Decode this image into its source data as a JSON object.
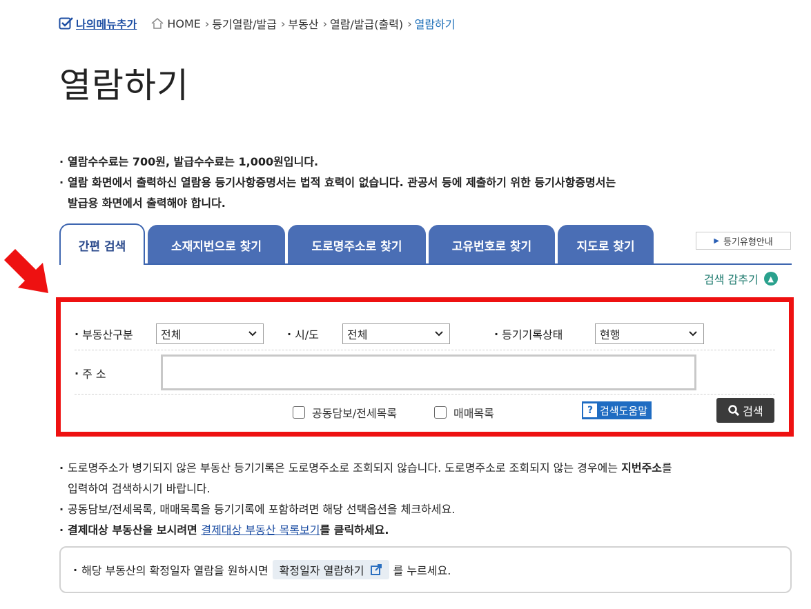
{
  "breadcrumb": {
    "my_menu_label": "나의메뉴추가",
    "items": [
      "HOME",
      "등기열람/발급",
      "부동산",
      "열람/발급(출력)"
    ],
    "current": "열람하기"
  },
  "page_title": "열람하기",
  "top_notes": [
    "열람수수료는 700원, 발급수수료는 1,000원입니다.",
    "열람 화면에서 출력하신 열람용 등기사항증명서는 법적 효력이 없습니다. 관공서 등에 제출하기 위한 등기사항증명서는",
    "발급용 화면에서 출력해야 합니다."
  ],
  "tabs": [
    {
      "label": "간편 검색",
      "active": true
    },
    {
      "label": "소재지번으로 찾기",
      "active": false
    },
    {
      "label": "도로명주소로 찾기",
      "active": false
    },
    {
      "label": "고유번호로 찾기",
      "active": false
    },
    {
      "label": "지도로 찾기",
      "active": false
    }
  ],
  "guide_button_label": "등기유형안내",
  "hide_search_label": "검색 감추기",
  "search_form": {
    "property_type_label": "부동산구분",
    "property_type_value": "전체",
    "region_label": "시/도",
    "region_value": "전체",
    "record_status_label": "등기기록상태",
    "record_status_value": "현행",
    "address_label": "주 소",
    "address_value": "",
    "checkbox_joint_label": "공동담보/전세목록",
    "checkbox_trade_label": "매매목록",
    "help_label": "검색도움말",
    "search_label": "검색"
  },
  "bottom_notes": {
    "note1_a": "도로명주소가 병기되지 않은 부동산 등기기록은 도로명주소로 조회되지 않습니다. 도로명주소로 조회되지 않는 경우에는 ",
    "note1_bold": "지번주소",
    "note1_b": "를",
    "note1_line2": "입력하여 검색하시기 바랍니다.",
    "note2": "공동담보/전세목록, 매매목록을 등기기록에 포함하려면 해당 선택옵션을 체크하세요.",
    "note3_a": "결제대상 부동산을 보시려면 ",
    "note3_link": "결제대상 부동산 목록보기",
    "note3_b": "를 클릭하세요."
  },
  "info_box": {
    "text_before": "해당 부동산의 확정일자 열람을 원하시면",
    "button_label": "확정일자 열람하기",
    "text_after": "를 누르세요."
  },
  "colors": {
    "tab_blue": "#4a6eb5",
    "annotation_red": "#ee1111",
    "link_blue": "#1d4ea3",
    "help_blue": "#1f6cc2",
    "hide_green": "#2aa18d"
  }
}
